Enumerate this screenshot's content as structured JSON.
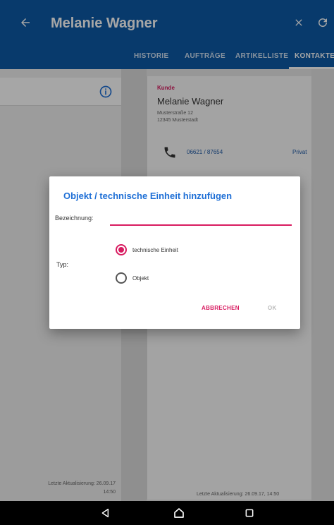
{
  "app": {
    "title": "Melanie Wagner"
  },
  "tabs": [
    {
      "label": "HISTORIE"
    },
    {
      "label": "AUFTRÄGE"
    },
    {
      "label": "ARTIKELLISTE"
    },
    {
      "label": "KONTAKTE"
    }
  ],
  "left": {
    "footer_line1": "Letzte Aktualisierung: 26.09.17",
    "footer_line2": "14:50"
  },
  "card": {
    "label": "Kunde",
    "name": "Melanie Wagner",
    "address_line1": "Musterstraße 12",
    "address_line2": "12345 Musterstadt",
    "phone_number": "06621 / 87654",
    "phone_label": "Privat",
    "footer": "Letzte Aktualisierung: 26.09.17, 14:50"
  },
  "dialog": {
    "title": "Objekt / technische Einheit hinzufügen",
    "name_label": "Bezeichnung:",
    "name_value": "",
    "type_label": "Typ:",
    "option_technical": "technische Einheit",
    "option_object": "Objekt",
    "selected": "technische Einheit",
    "cancel_label": "ABBRECHEN",
    "ok_label": "OK"
  },
  "colors": {
    "primary": "#0d5aa7",
    "accent": "#d81b60",
    "dialog_title": "#1e6fd6"
  },
  "icons": {
    "back": "arrow-left",
    "close": "x",
    "refresh": "refresh",
    "info": "info-circle",
    "phone": "phone",
    "nav_back": "triangle-left",
    "nav_home": "house",
    "nav_recent": "square"
  }
}
